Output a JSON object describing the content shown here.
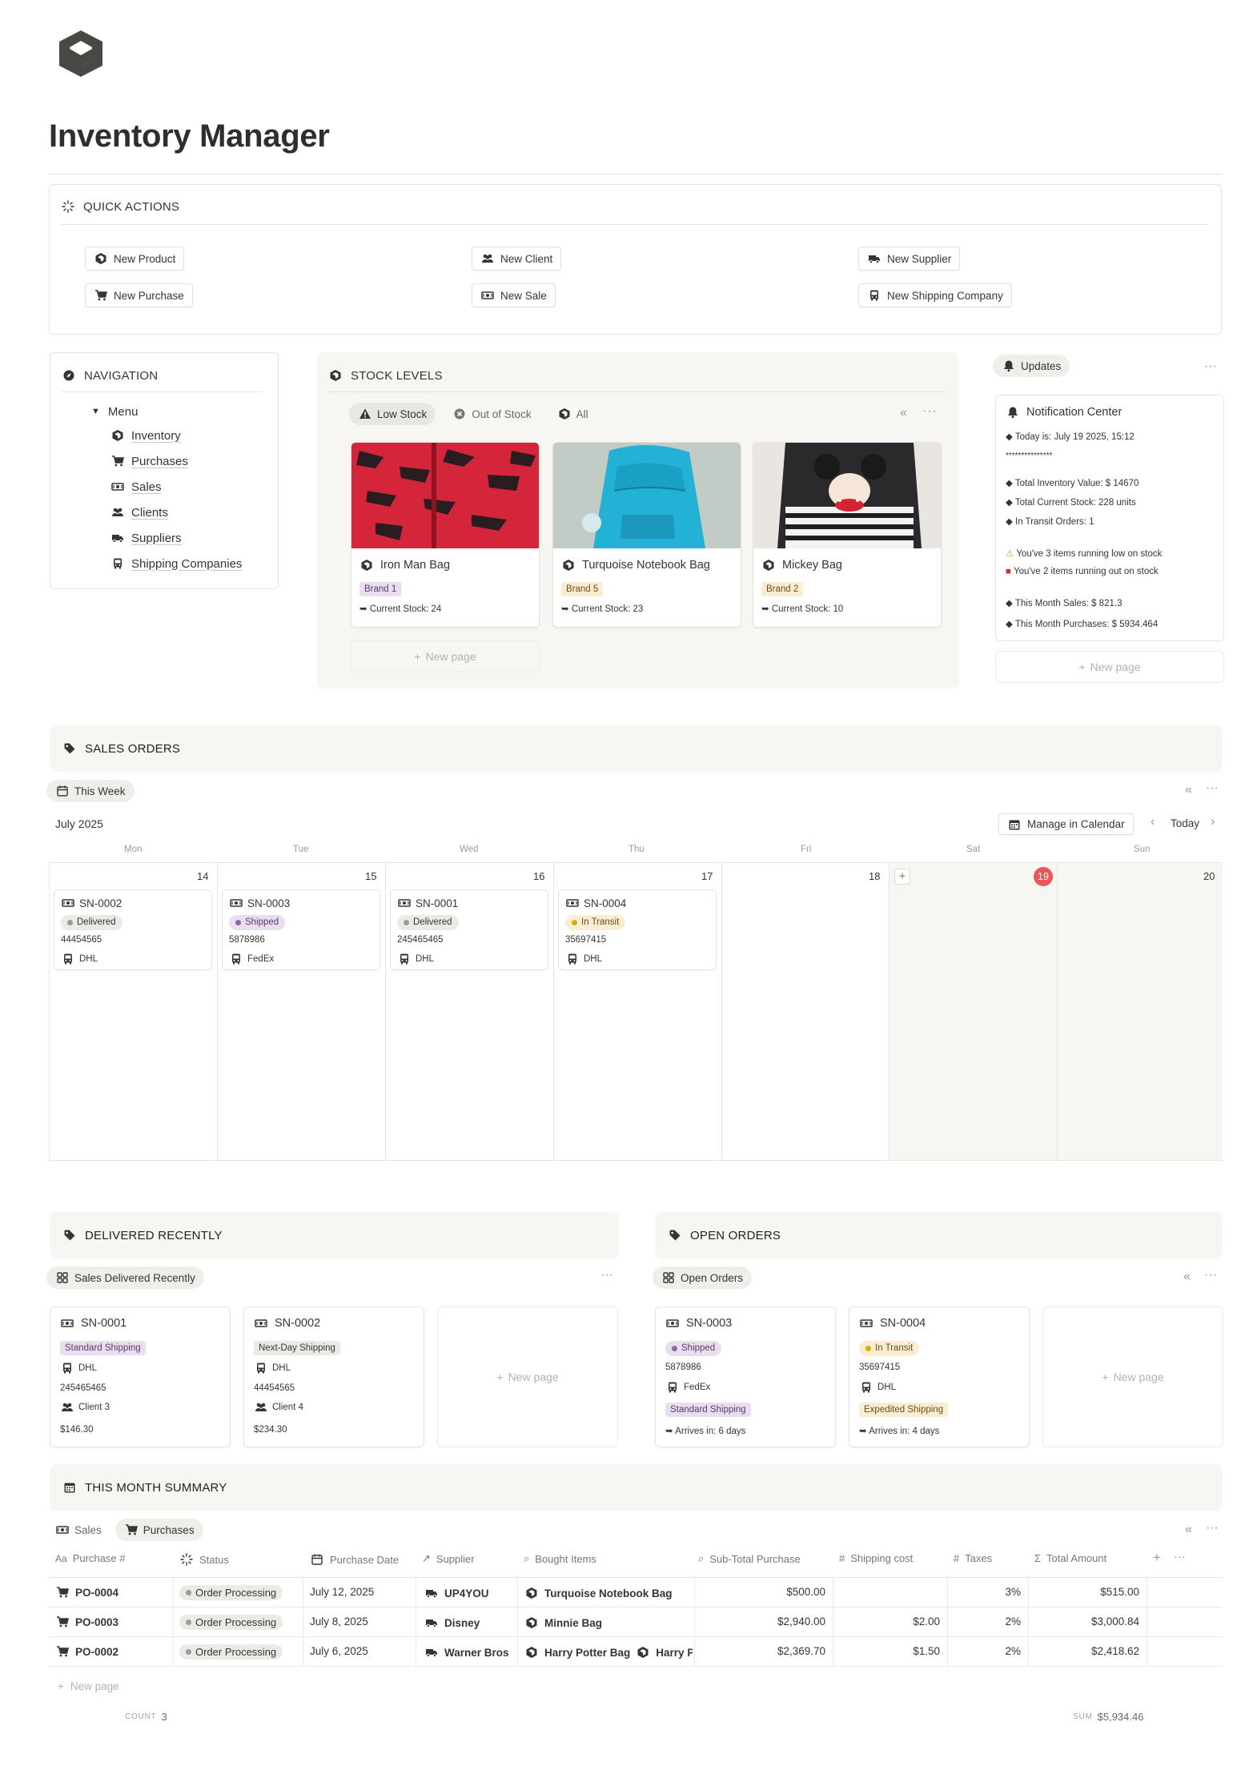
{
  "page": {
    "title": "Inventory Manager",
    "logo_icon": "cube-logo-icon"
  },
  "quick_actions": {
    "title": "QUICK ACTIONS",
    "buttons": [
      {
        "label": "New Product",
        "icon": "cube-icon"
      },
      {
        "label": "New Client",
        "icon": "people-icon"
      },
      {
        "label": "New Supplier",
        "icon": "truck-icon"
      },
      {
        "label": "New Purchase",
        "icon": "cart-icon"
      },
      {
        "label": "New Sale",
        "icon": "money-icon"
      },
      {
        "label": "New Shipping Company",
        "icon": "bus-icon"
      }
    ]
  },
  "navigation": {
    "title": "NAVIGATION",
    "menu_label": "Menu",
    "items": [
      "Inventory",
      "Purchases",
      "Sales",
      "Clients",
      "Suppliers",
      "Shipping Companies"
    ]
  },
  "stock_levels": {
    "title": "STOCK LEVELS",
    "tabs": [
      "Low Stock",
      "Out of Stock",
      "All"
    ],
    "cards": [
      {
        "name": "Iron Man Bag",
        "brand": "Brand 1",
        "stock": "Current Stock: 24"
      },
      {
        "name": "Turquoise Notebook Bag",
        "brand": "Brand 5",
        "stock": "Current Stock: 23"
      },
      {
        "name": "Mickey Bag",
        "brand": "Brand 2",
        "stock": "Current Stock: 10"
      }
    ],
    "new_page": "New page"
  },
  "updates": {
    "tab": "Updates",
    "title": "Notification Center",
    "today_label": "Today is:",
    "today_value": "July 19 2025, 15:12",
    "stars": "***************",
    "inventory_value_label": "Total Inventory Value:",
    "inventory_value": "$ 14670",
    "current_stock_label": "Total Current Stock:",
    "current_stock": "228 units",
    "transit_label": "In Transit Orders:",
    "transit": "1",
    "warn_low": "You've 3 items running low on stock",
    "warn_out": "You've 2 items running out on stock",
    "sales_label": "This Month Sales:",
    "sales": "$ 821.3",
    "purchases_label": "This Month Purchases:",
    "purchases": "$ 5934.464",
    "new_page": "New page"
  },
  "sales_orders": {
    "title": "SALES ORDERS",
    "view": "This Week",
    "month": "July 2025",
    "manage": "Manage in Calendar",
    "today": "Today",
    "days": [
      "Mon",
      "Tue",
      "Wed",
      "Thu",
      "Fri",
      "Sat",
      "Sun"
    ],
    "dates": [
      "14",
      "15",
      "16",
      "17",
      "18",
      "19",
      "20"
    ],
    "orders": [
      {
        "id": "SN-0002",
        "status": "Delivered",
        "tracking": "44454565",
        "carrier": "DHL"
      },
      {
        "id": "SN-0003",
        "status": "Shipped",
        "tracking": "5878986",
        "carrier": "FedEx"
      },
      {
        "id": "SN-0001",
        "status": "Delivered",
        "tracking": "245465465",
        "carrier": "DHL"
      },
      {
        "id": "SN-0004",
        "status": "In Transit",
        "tracking": "35697415",
        "carrier": "DHL"
      }
    ]
  },
  "delivered_recently": {
    "title": "DELIVERED RECENTLY",
    "view": "Sales Delivered Recently",
    "cards": [
      {
        "id": "SN-0001",
        "shipping": "Standard Shipping",
        "carrier": "DHL",
        "tracking": "245465465",
        "client": "Client 3",
        "amount": "$146.30"
      },
      {
        "id": "SN-0002",
        "shipping": "Next-Day Shipping",
        "carrier": "DHL",
        "tracking": "44454565",
        "client": "Client 4",
        "amount": "$234.30"
      }
    ],
    "new_page": "New page"
  },
  "open_orders": {
    "title": "OPEN ORDERS",
    "view": "Open Orders",
    "cards": [
      {
        "id": "SN-0003",
        "status": "Shipped",
        "tracking": "5878986",
        "carrier": "FedEx",
        "shipping": "Standard Shipping",
        "arrives_label": "Arrives in:",
        "arrives": "6 days"
      },
      {
        "id": "SN-0004",
        "status": "In Transit",
        "tracking": "35697415",
        "carrier": "DHL",
        "shipping": "Expedited Shipping",
        "arrives_label": "Arrives in:",
        "arrives": "4 days"
      }
    ],
    "new_page": "New page"
  },
  "summary": {
    "title": "THIS MONTH SUMMARY",
    "tabs": [
      "Sales",
      "Purchases"
    ],
    "columns": [
      "Purchase #",
      "Status",
      "Purchase Date",
      "Supplier",
      "Bought Items",
      "Sub-Total Purchase",
      "Shipping cost",
      "Taxes",
      "Total Amount"
    ],
    "rows": [
      {
        "id": "PO-0004",
        "status": "Order Processing",
        "date": "July 12, 2025",
        "supplier": "UP4YOU",
        "items": "Turquoise Notebook Bag",
        "items2": "",
        "subtotal": "$500.00",
        "shipping": "",
        "taxes": "3%",
        "total": "$515.00"
      },
      {
        "id": "PO-0003",
        "status": "Order Processing",
        "date": "July 8, 2025",
        "supplier": "Disney",
        "items": "Minnie Bag",
        "items2": "",
        "subtotal": "$2,940.00",
        "shipping": "$2.00",
        "taxes": "2%",
        "total": "$3,000.84"
      },
      {
        "id": "PO-0002",
        "status": "Order Processing",
        "date": "July 6, 2025",
        "supplier": "Warner Bros",
        "items": "Harry Potter Bag",
        "items2": "Harry Po",
        "subtotal": "$2,369.70",
        "shipping": "$1.50",
        "taxes": "2%",
        "total": "$2,418.62"
      }
    ],
    "new_page": "New page",
    "count_label": "COUNT",
    "count": "3",
    "sum_label": "SUM",
    "sum": "$5,934.46"
  },
  "colors": {
    "delivered": "#9b9a97",
    "shipped": "#9065b0",
    "in_transit": "#dfab01",
    "today_badge": "#eb5757"
  }
}
